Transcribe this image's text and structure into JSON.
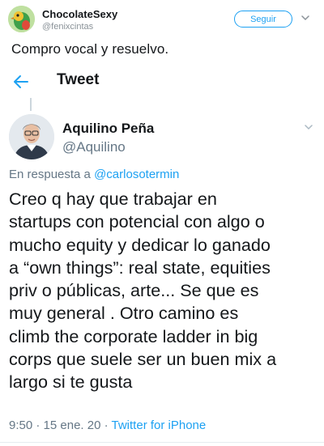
{
  "outer_tweet": {
    "display_name": "ChocolateSexy",
    "handle": "@fenixcintas",
    "follow_label": "Seguir",
    "text": "Compro vocal y resuelvo."
  },
  "header": {
    "title": "Tweet"
  },
  "tweet": {
    "author_name": "Aquilino Peña",
    "author_handle": "@Aquilino",
    "reply_prefix": "En respuesta a ",
    "reply_mention": "@carlosotermin",
    "body": "Creo q hay que trabajar en\nstartups con potencial con algo o\nmucho equity y dedicar lo ganado\na “own things”: real state, equities\npriv o públicas, arte... Se que es\nmuy general . Otro camino es\nclimb the corporate ladder in big\ncorps que suele ser un buen mix a\nlargo si te gusta",
    "time": "9:50",
    "date": "15 ene. 20",
    "separator": " · ",
    "source": "Twitter for iPhone"
  },
  "colors": {
    "accent": "#1da1f2",
    "muted": "#657786",
    "text": "#14171a"
  },
  "icons": {
    "back": "back-arrow-icon",
    "menu": "chevron-down-icon"
  }
}
